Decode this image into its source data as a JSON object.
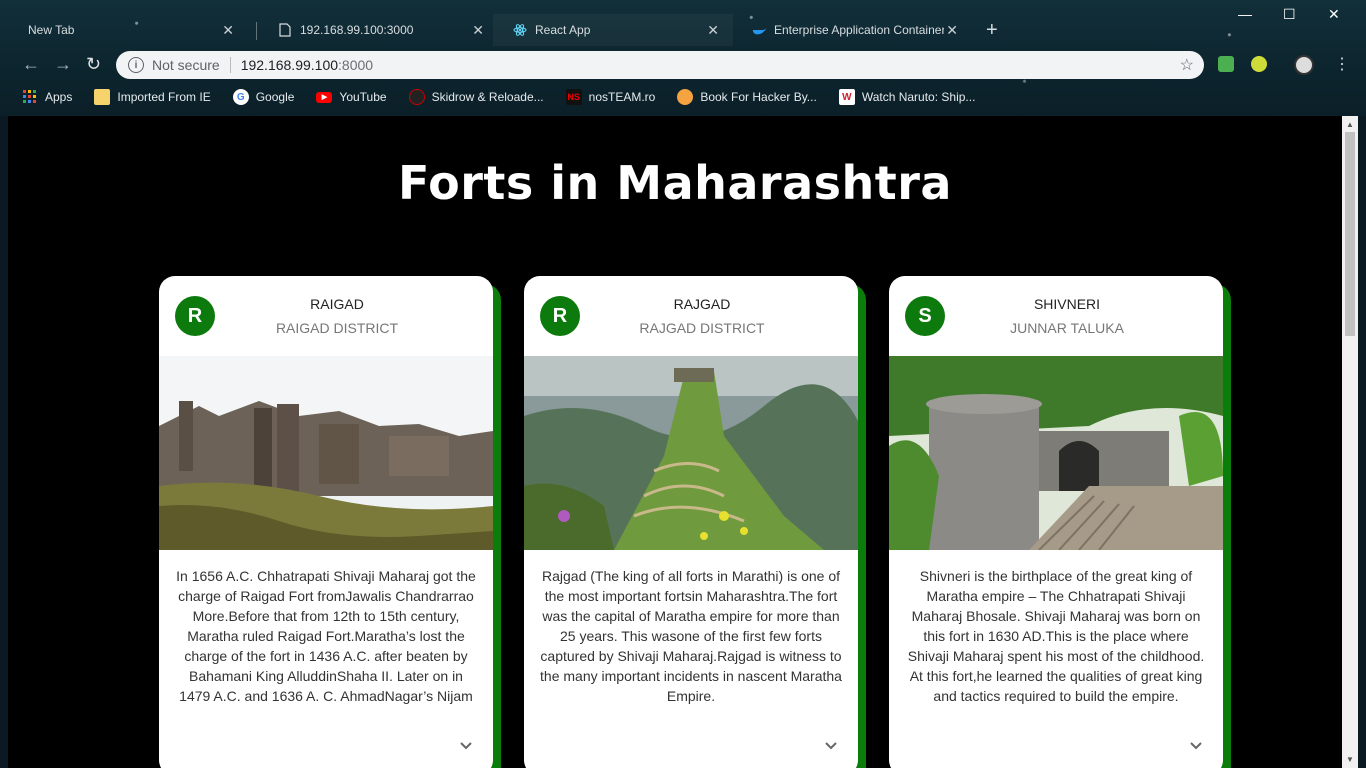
{
  "browser": {
    "tabs": [
      {
        "title": "New Tab",
        "icon": "blank-icon"
      },
      {
        "title": "192.168.99.100:3000",
        "icon": "document-icon"
      },
      {
        "title": "React App",
        "icon": "react-icon"
      },
      {
        "title": "Enterprise Application Container",
        "icon": "docker-icon"
      }
    ],
    "new_tab_label": "+",
    "address": {
      "security_label": "Not secure",
      "host": "192.168.99.100",
      "port": ":8000"
    },
    "bookmarks": [
      {
        "label": "Apps",
        "icon": "apps-grid-icon"
      },
      {
        "label": "Imported From IE",
        "icon": "folder-icon"
      },
      {
        "label": "Google",
        "icon": "google-icon"
      },
      {
        "label": "YouTube",
        "icon": "youtube-icon"
      },
      {
        "label": "Skidrow & Reloade...",
        "icon": "skidrow-icon"
      },
      {
        "label": "nosTEAM.ro",
        "icon": "nosteam-icon"
      },
      {
        "label": "Book For Hacker By...",
        "icon": "book-icon"
      },
      {
        "label": "Watch Naruto: Ship...",
        "icon": "w-icon"
      }
    ]
  },
  "page": {
    "title": "Forts in Maharashtra",
    "cards": [
      {
        "avatar": "R",
        "title": "RAIGAD",
        "subtitle": "RAIGAD DISTRICT",
        "text": "In 1656 A.C. Chhatrapati Shivaji Maharaj got the charge of Raigad Fort fromJawalis Chandrarrao More.Before that from 12th to 15th century, Maratha ruled Raigad Fort.Maratha’s lost the charge of the fort in 1436 A.C. after beaten by Bahamani King AlluddinShaha II. Later on in 1479 A.C. and 1636 A. C. AhmadNagar’s Nijam"
      },
      {
        "avatar": "R",
        "title": "RAJGAD",
        "subtitle": "RAJGAD DISTRICT",
        "text": "Rajgad (The king of all forts in Marathi) is one of the most important fortsin Maharashtra.The fort was the capital of Maratha empire for more than 25 years. This wasone of the first few forts captured by Shivaji Maharaj.Rajgad is witness to the many important incidents in nascent Maratha Empire."
      },
      {
        "avatar": "S",
        "title": "SHIVNERI",
        "subtitle": "JUNNAR TALUKA",
        "text": "Shivneri is the birthplace of the great king of Maratha empire – The Chhatrapati Shivaji Maharaj Bhosale. Shivaji Maharaj was born on this fort in 1630 AD.This is the place where Shivaji Maharaj spent his most of the childhood. At this fort,he learned the qualities of great king and tactics required to build the empire."
      }
    ]
  },
  "colors": {
    "accent_green": "#0d7a0d",
    "page_background": "#000000"
  }
}
